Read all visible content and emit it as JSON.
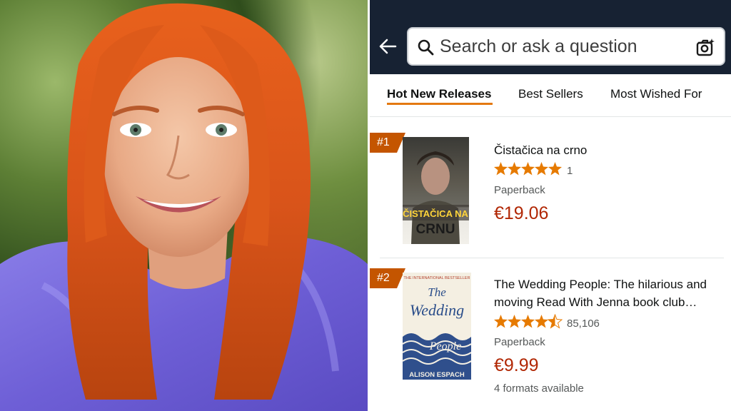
{
  "search": {
    "placeholder": "Search or ask a question"
  },
  "icons": {
    "back": "back-arrow-icon",
    "search": "search-icon",
    "camera": "camera-lens-icon"
  },
  "tabs": [
    {
      "label": "Hot New Releases",
      "active": true
    },
    {
      "label": "Best Sellers",
      "active": false
    },
    {
      "label": "Most Wished For",
      "active": false
    }
  ],
  "products": [
    {
      "rank": "#1",
      "title": "Čistačica na crno",
      "rating": 5,
      "rating_count": "1",
      "format": "Paperback",
      "price": "€19.06",
      "cover_text": [
        "ČISTAČICA NA",
        "CRNU"
      ]
    },
    {
      "rank": "#2",
      "title": "The Wedding People: The hilarious and moving Read With Jenna book club…",
      "rating": 4.5,
      "rating_count": "85,106",
      "format": "Paperback",
      "price": "€9.99",
      "formats_available": "4 formats available",
      "cover_text": [
        "THE INTERNATIONAL BESTSELLER",
        "The",
        "Wedding",
        "People",
        "ALISON ESPACH"
      ]
    }
  ],
  "colors": {
    "topbar": "#172233",
    "accent_underline": "#e47911",
    "rank_badge": "#c45500",
    "price": "#b12704",
    "star": "#e67a00"
  }
}
